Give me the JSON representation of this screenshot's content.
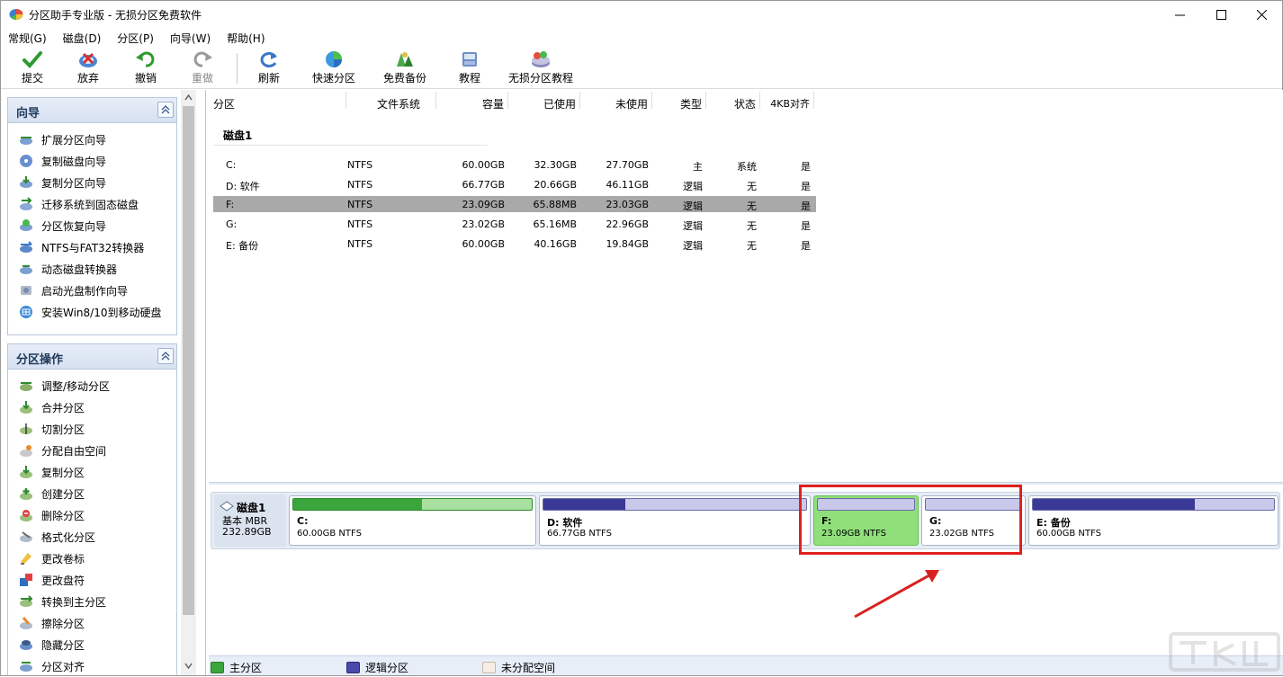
{
  "window": {
    "title": "分区助手专业版 - 无损分区免费软件"
  },
  "menu": [
    "常规(G)",
    "磁盘(D)",
    "分区(P)",
    "向导(W)",
    "帮助(H)"
  ],
  "toolbar": {
    "submit": "提交",
    "discard": "放弃",
    "undo": "撤销",
    "redo": "重做",
    "refresh": "刷新",
    "quick_partition": "快速分区",
    "free_backup": "免费备份",
    "tutorial": "教程",
    "lossless_tutorial": "无损分区教程"
  },
  "wizard_panel": {
    "title": "向导",
    "items": [
      "扩展分区向导",
      "复制磁盘向导",
      "复制分区向导",
      "迁移系统到固态磁盘",
      "分区恢复向导",
      "NTFS与FAT32转换器",
      "动态磁盘转换器",
      "启动光盘制作向导",
      "安装Win8/10到移动硬盘"
    ]
  },
  "ops_panel": {
    "title": "分区操作",
    "items": [
      "调整/移动分区",
      "合并分区",
      "切割分区",
      "分配自由空间",
      "复制分区",
      "创建分区",
      "删除分区",
      "格式化分区",
      "更改卷标",
      "更改盘符",
      "转换到主分区",
      "擦除分区",
      "隐藏分区",
      "分区对齐"
    ]
  },
  "table": {
    "headers": [
      "分区",
      "文件系统",
      "容量",
      "已使用",
      "未使用",
      "类型",
      "状态",
      "4KB对齐"
    ],
    "disk_label": "磁盘1",
    "rows": [
      {
        "name": "C:",
        "fs": "NTFS",
        "cap": "60.00GB",
        "used": "32.30GB",
        "free": "27.70GB",
        "type": "主",
        "status": "系统",
        "align": "是"
      },
      {
        "name": "D: 软件",
        "fs": "NTFS",
        "cap": "66.77GB",
        "used": "20.66GB",
        "free": "46.11GB",
        "type": "逻辑",
        "status": "无",
        "align": "是"
      },
      {
        "name": "F:",
        "fs": "NTFS",
        "cap": "23.09GB",
        "used": "65.88MB",
        "free": "23.03GB",
        "type": "逻辑",
        "status": "无",
        "align": "是"
      },
      {
        "name": "G:",
        "fs": "NTFS",
        "cap": "23.02GB",
        "used": "65.16MB",
        "free": "22.96GB",
        "type": "逻辑",
        "status": "无",
        "align": "是"
      },
      {
        "name": "E: 备份",
        "fs": "NTFS",
        "cap": "60.00GB",
        "used": "40.16GB",
        "free": "19.84GB",
        "type": "逻辑",
        "status": "无",
        "align": "是"
      }
    ],
    "selected_row": 2
  },
  "disk_map": {
    "disk_name": "磁盘1",
    "disk_type": "基本 MBR",
    "disk_size": "232.89GB",
    "partitions": [
      {
        "name": "C:",
        "desc": "60.00GB NTFS",
        "used_fraction": 0.54,
        "kind": "primary"
      },
      {
        "name": "D: 软件",
        "desc": "66.77GB NTFS",
        "used_fraction": 0.31,
        "kind": "logical"
      },
      {
        "name": "F:",
        "desc": "23.09GB NTFS",
        "used_fraction": 0.0,
        "kind": "logical",
        "selected": true
      },
      {
        "name": "G:",
        "desc": "23.02GB NTFS",
        "used_fraction": 0.0,
        "kind": "logical"
      },
      {
        "name": "E: 备份",
        "desc": "60.00GB NTFS",
        "used_fraction": 0.67,
        "kind": "logical"
      }
    ]
  },
  "legend": {
    "primary": "主分区",
    "logical": "逻辑分区",
    "unallocated": "未分配空间"
  },
  "colors": {
    "primary_fill": "#3aa53a",
    "logical_fill": "#3a3a96",
    "selected_partition": "#8fe07a",
    "highlight_box": "#e02020",
    "selected_row": "#a9a9a9"
  }
}
